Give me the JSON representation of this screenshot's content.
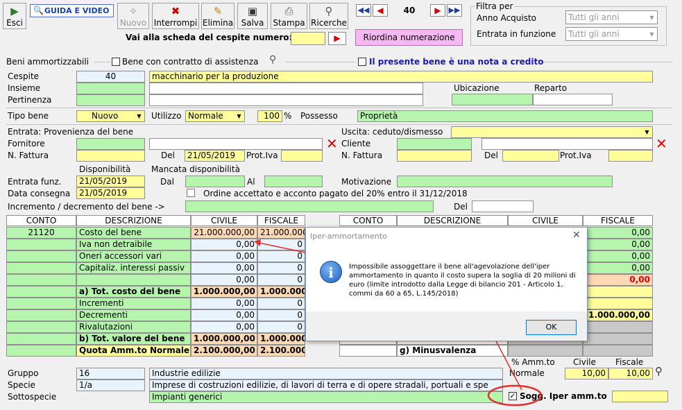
{
  "toolbar": {
    "esci": "Esci",
    "guida": "GUIDA E VIDEO",
    "nuovo": "Nuovo",
    "interrompi": "Interrompi",
    "elimina": "Elimina",
    "salva": "Salva",
    "stampa": "Stampa",
    "ricerche": "Ricerche",
    "record": "40",
    "vai_label": "Vai alla scheda del cespite numero:",
    "riordina": "Riordina numerazione"
  },
  "filter": {
    "title": "Filtra per",
    "anno_label": "Anno Acquisto",
    "anno_value": "Tutti gli anni",
    "entrata_label": "Entrata in funzione",
    "entrata_value": "Tutti gli anni"
  },
  "header": {
    "beni": "Beni ammortizzabili",
    "contratto": "Bene con contratto di assistenza",
    "nota": "Il presente bene è una nota a credito"
  },
  "cespite": {
    "label": "Cespite",
    "num": "40",
    "desc": "macchinario per la produzione",
    "insieme": "Insieme",
    "pertinenza": "Pertinenza",
    "ubicazione": "Ubicazione",
    "reparto": "Reparto"
  },
  "tipo": {
    "label": "Tipo bene",
    "value": "Nuovo",
    "utilizzo_label": "Utilizzo",
    "utilizzo": "Normale",
    "perc": "100",
    "perc_sign": "%",
    "possesso_label": "Possesso",
    "possesso": "Proprietà"
  },
  "entrata": {
    "provenienza": "Entrata: Provenienza del bene",
    "fornitore": "Fornitore",
    "nfattura": "N. Fattura",
    "del": "Del",
    "data": "21/05/2019",
    "protiva": "Prot.Iva"
  },
  "uscita": {
    "label": "Uscita: ceduto/dismesso",
    "cliente": "Cliente",
    "nfattura": "N. Fattura",
    "del": "Del",
    "protiva": "Prot.Iva"
  },
  "disp": {
    "disponibilita": "Disponibilità",
    "mancata": "Mancata disponibilità",
    "entrata_funz": "Entrata funz.",
    "entrata_funz_val": "21/05/2019",
    "data_consegna": "Data consegna",
    "data_consegna_val": "21/05/2019",
    "dal": "Dal",
    "al": "Al",
    "motivazione": "Motivazione",
    "ordine": "Ordine accettato e acconto pagato del 20% entro il 31/12/2018",
    "incremento": "Incremento / decremento del bene ->",
    "del": "Del"
  },
  "left_table": {
    "headers": [
      "CONTO",
      "DESCRIZIONE",
      "CIVILE",
      "FISCALE"
    ],
    "conto": "21120",
    "rows": [
      {
        "desc": "Costo del bene",
        "civ": "21.000.000,00",
        "fis": "21.000.000,"
      },
      {
        "desc": "Iva non detraibile",
        "civ": "0,00",
        "fis": "0"
      },
      {
        "desc": "Oneri accessori vari",
        "civ": "0,00",
        "fis": "0"
      },
      {
        "desc": "Capitaliz. interessi passiv",
        "civ": "0,00",
        "fis": "0"
      },
      {
        "desc": "",
        "civ": "0,00",
        "fis": "0"
      },
      {
        "desc": "a) Tot. costo del bene",
        "civ": "1.000.000,00",
        "fis": "1.000.000"
      },
      {
        "desc": "Incrementi",
        "civ": "0,00",
        "fis": "0"
      },
      {
        "desc": "Decrementi",
        "civ": "0,00",
        "fis": "0"
      },
      {
        "desc": "Rivalutazioni",
        "civ": "0,00",
        "fis": "0"
      },
      {
        "desc": "b) Tot. valore del bene",
        "civ": "1.000.000,00",
        "fis": "1.000.000"
      },
      {
        "desc": "Quota Amm.to Normale",
        "civ": "2.100.000,00",
        "fis": "2.100.000,00"
      }
    ]
  },
  "right_table": {
    "headers": [
      "CONTO",
      "DESCRIZIONE",
      "CIVILE",
      "FISCALE"
    ],
    "values": [
      "0,00",
      "0,00",
      "0,00",
      "0,00",
      "0,00"
    ],
    "value_b": "1.000.000,00",
    "minus": "g) Minusvalenza"
  },
  "classif": {
    "gruppo": "Gruppo",
    "gruppo_num": "16",
    "gruppo_desc": "Industrie edilizie",
    "specie": "Specie",
    "specie_num": "1/a",
    "specie_desc": "Imprese di costruzioni edilizie, di lavori di terra e di opere stradali, portuali e spe",
    "sottospecie": "Sottospecie",
    "sottospecie_desc": "Impianti generici"
  },
  "amm": {
    "perc_label": "% Amm.to",
    "civile": "Civile",
    "fiscale": "Fiscale",
    "normale": "Normale",
    "civ_val": "10,00",
    "fis_val": "10,00",
    "sogg": "Sogg. Iper amm.to"
  },
  "dialog": {
    "title": "Iper-ammortamento",
    "message": "Impossibile assoggettare il bene all'agevolazione dell'iper ammortamento in quanto il costo supera la soglia di 20 milioni di euro (limite introdotto dalla Legge di bilancio 201 - Articolo 1, commi da 60 a 65, L.145/2018)",
    "ok": "OK"
  },
  "colors": {
    "green": "#b5f5ae",
    "yellow": "#fffe9a",
    "light_blue": "#e9f3fb",
    "orange": "#ffd9b3",
    "red": "#e00000",
    "magenta": "#f5b8f0",
    "annotation": "#e03030"
  }
}
